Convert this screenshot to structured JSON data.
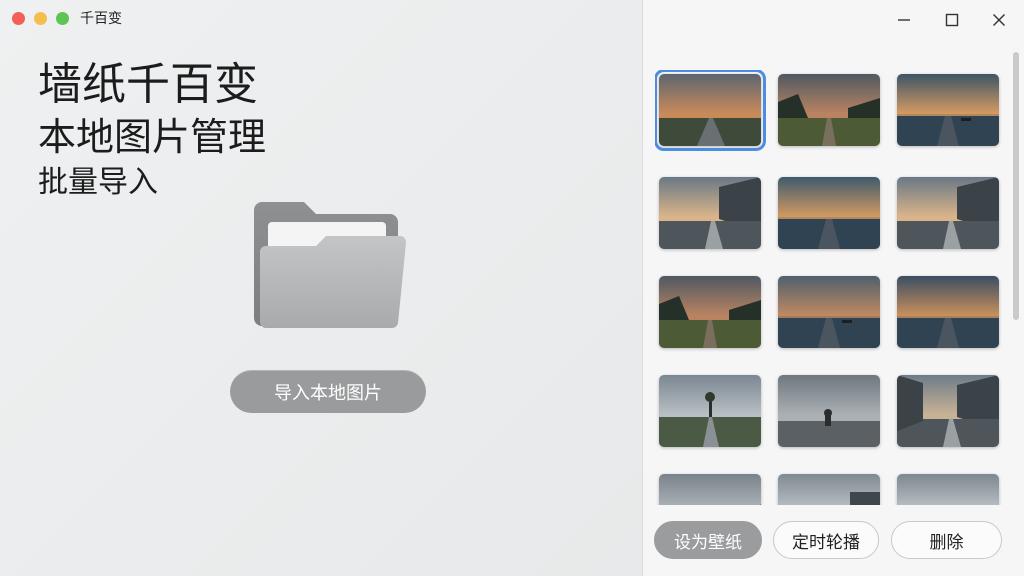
{
  "app": {
    "title": "千百变"
  },
  "left": {
    "headline1": "墙纸千百变",
    "headline2": "本地图片管理",
    "headline3": "批量导入",
    "import_button": "导入本地图片",
    "folder_icon": "folder-icon"
  },
  "window_controls": {
    "minimize_icon": "minimize-icon",
    "maximize_icon": "maximize-icon",
    "close_icon": "close-icon"
  },
  "thumbnails": [
    {
      "scene": "road-sunset",
      "selected": true
    },
    {
      "scene": "forest-path-dusk",
      "selected": false
    },
    {
      "scene": "lake-boat-sunset",
      "selected": false
    },
    {
      "scene": "street-buildings",
      "selected": false
    },
    {
      "scene": "lake-pier",
      "selected": false
    },
    {
      "scene": "street-buildings",
      "selected": false
    },
    {
      "scene": "forest-path-dusk",
      "selected": false
    },
    {
      "scene": "lake-boat",
      "selected": false
    },
    {
      "scene": "lake-pier-dusk",
      "selected": false
    },
    {
      "scene": "road-tree-gray",
      "selected": false
    },
    {
      "scene": "beach-figure-gray",
      "selected": false
    },
    {
      "scene": "city-street",
      "selected": false
    },
    {
      "scene": "figure-cliff",
      "selected": false
    },
    {
      "scene": "figure-building",
      "selected": false
    },
    {
      "scene": "lake-shore",
      "selected": false
    }
  ],
  "actions": {
    "set_wallpaper": "设为壁纸",
    "slideshow": "定时轮播",
    "delete": "删除"
  },
  "colors": {
    "accent_selection": "#4b8de0",
    "primary_button": "#9b9c9e"
  }
}
